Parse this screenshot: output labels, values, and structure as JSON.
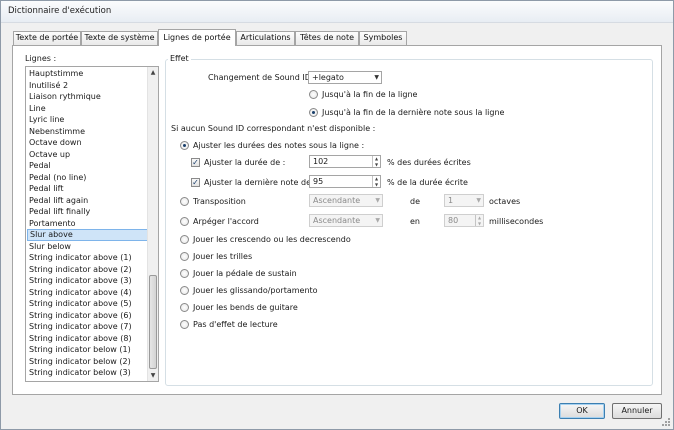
{
  "window": {
    "title": "Dictionnaire d'exécution"
  },
  "tabs": [
    {
      "label": "Texte de portée"
    },
    {
      "label": "Texte de système"
    },
    {
      "label": "Lignes de portée"
    },
    {
      "label": "Articulations"
    },
    {
      "label": "Têtes de note"
    },
    {
      "label": "Symboles"
    }
  ],
  "active_tab": "Lignes de portée",
  "lines_panel": {
    "label": "Lignes :",
    "items": [
      "Hauptstimme",
      "Inutilisé 2",
      "Liaison rythmique",
      "Line",
      "Lyric line",
      "Nebenstimme",
      "Octave down",
      "Octave up",
      "Pedal",
      "Pedal (no line)",
      "Pedal lift",
      "Pedal lift again",
      "Pedal lift finally",
      "Portamento",
      "Slur above",
      "Slur below",
      "String indicator above (1)",
      "String indicator above (2)",
      "String indicator above (3)",
      "String indicator above (4)",
      "String indicator above (5)",
      "String indicator above (6)",
      "String indicator above (7)",
      "String indicator above (8)",
      "String indicator below (1)",
      "String indicator below (2)",
      "String indicator below (3)"
    ],
    "selected": "Slur above"
  },
  "effect": {
    "group_label": "Effet",
    "sound_id_label": "Changement de Sound ID :",
    "sound_id_value": "+legato",
    "until_end_line": "Jusqu'à la fin de la ligne",
    "until_last_note": "Jusqu'à la fin de la dernière note sous la ligne",
    "fallback_label": "Si aucun Sound ID correspondant n'est disponible :",
    "adjust_durations": "Ajuster les durées des notes sous la ligne :",
    "adjust_duration_label": "Ajuster la durée de :",
    "adjust_duration_value": "102",
    "adjust_duration_unit": "% des durées écrites",
    "adjust_last_label": "Ajuster la dernière note de :",
    "adjust_last_value": "95",
    "adjust_last_unit": "% de la durée écrite",
    "transposition": "Transposition",
    "transposition_dir": "Ascendante",
    "transposition_of": "de",
    "transposition_value": "1",
    "transposition_unit": "octaves",
    "arpeggio": "Arpéger l'accord",
    "arpeggio_dir": "Ascendante",
    "arpeggio_in": "en",
    "arpeggio_value": "80",
    "arpeggio_unit": "millisecondes",
    "crescendo": "Jouer les crescendo ou les decrescendo",
    "trills": "Jouer les trilles",
    "sustain": "Jouer la pédale de sustain",
    "glissando": "Jouer les glissando/portamento",
    "bends": "Jouer les bends de guitare",
    "no_effect": "Pas d'effet de lecture"
  },
  "buttons": {
    "ok": "OK",
    "cancel": "Annuler"
  }
}
